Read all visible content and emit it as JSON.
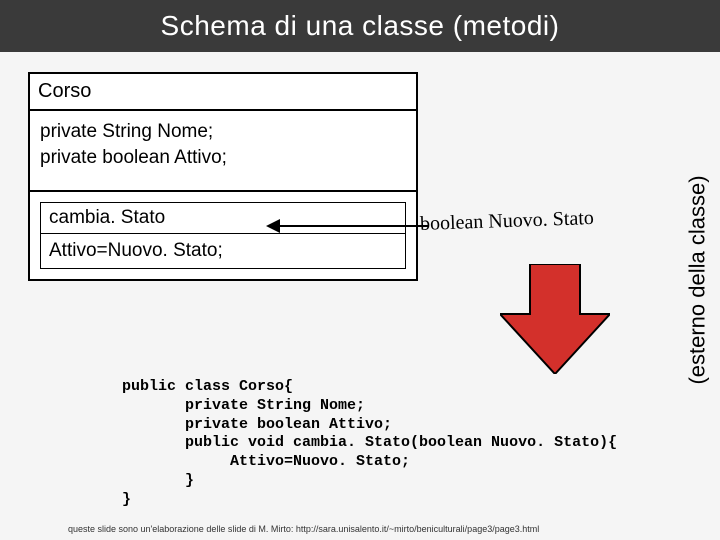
{
  "title": "Schema di una classe (metodi)",
  "class": {
    "name": "Corso",
    "attr1": "private String Nome;",
    "attr2": "private boolean Attivo;",
    "method_name": "cambia. Stato",
    "method_body": "Attivo=Nuovo. Stato;"
  },
  "param_label": "boolean Nuovo. Stato",
  "side_label": "(esterno della classe)",
  "code": "public class Corso{\n       private String Nome;\n       private boolean Attivo;\n       public void cambia. Stato(boolean Nuovo. Stato){\n            Attivo=Nuovo. Stato;\n       }\n}",
  "footnote": "queste slide sono un'elaborazione delle slide di M. Mirto: http://sara.unisalento.it/~mirto/beniculturali/page3/page3.html"
}
